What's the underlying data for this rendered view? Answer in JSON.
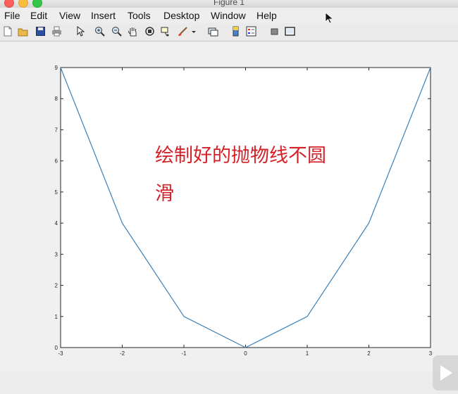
{
  "window": {
    "title": "Figure 1"
  },
  "menu": [
    "File",
    "Edit",
    "View",
    "Insert",
    "Tools",
    "Desktop",
    "Window",
    "Help"
  ],
  "toolbar": {
    "icons": [
      "new-figure-icon",
      "open-file-icon",
      "save-icon",
      "print-icon",
      "edit-plot-arrow-icon",
      "zoom-in-icon",
      "zoom-out-icon",
      "pan-hand-icon",
      "rotate-3d-icon",
      "data-cursor-icon",
      "brush-icon",
      "brush-dropdown-icon",
      "link-plot-icon",
      "colorbar-icon",
      "legend-icon",
      "hide-plot-tools-icon",
      "show-plot-tools-icon"
    ]
  },
  "annotation": {
    "line1": "绘制好的抛物线不圆",
    "line2": "滑",
    "color": "#d42128"
  },
  "chart_data": {
    "type": "line",
    "x": [
      -3,
      -2,
      -1,
      0,
      1,
      2,
      3
    ],
    "series": [
      {
        "values": [
          9,
          4,
          1,
          0,
          1,
          4,
          9
        ],
        "color": "#3a7fb8"
      }
    ],
    "xlim": [
      -3,
      3
    ],
    "ylim": [
      0,
      9
    ],
    "xticks": [
      "-3",
      "-2",
      "-1",
      "0",
      "1",
      "2",
      "3"
    ],
    "yticks": [
      "0",
      "1",
      "2",
      "3",
      "4",
      "5",
      "6",
      "7",
      "8",
      "9"
    ],
    "title": "",
    "xlabel": "",
    "ylabel": "",
    "grid": false
  }
}
